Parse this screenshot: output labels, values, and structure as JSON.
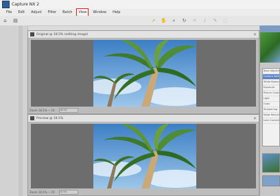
{
  "window": {
    "title": "Capture NX 2"
  },
  "menu": {
    "items": [
      "File",
      "Edit",
      "Adjust",
      "Filter",
      "Batch",
      "View",
      "Window",
      "Help"
    ],
    "highlighted": "View"
  },
  "toolbar": {
    "tools": [
      "pointer-tool",
      "hand-tool",
      "zoom-tool",
      "rotate-tool",
      "crop-tool",
      "straighten-tool",
      "brush-tool",
      "selection-tool"
    ]
  },
  "panes": {
    "top": {
      "title": "Original @ 18.5% (editing image)",
      "status": "Zoom 18.5% — Fit",
      "zoom": "18.5%"
    },
    "bottom": {
      "title": "Preview @ 18.5%",
      "status": "Zoom 18.5% — Fit",
      "zoom": "18.5%"
    }
  },
  "right_panel": {
    "list": [
      "Base Adjustments",
      "Camera Settings",
      "White Balance",
      "Exposure",
      "Picture Control",
      "Light",
      "Color",
      "Sharpening",
      "Noise Reduction",
      "Lens Corrections"
    ],
    "selected_index": 1
  },
  "colors": {
    "highlight": "#e8221b",
    "sky": "#5b97d1",
    "palm": "#3f7a2c"
  }
}
